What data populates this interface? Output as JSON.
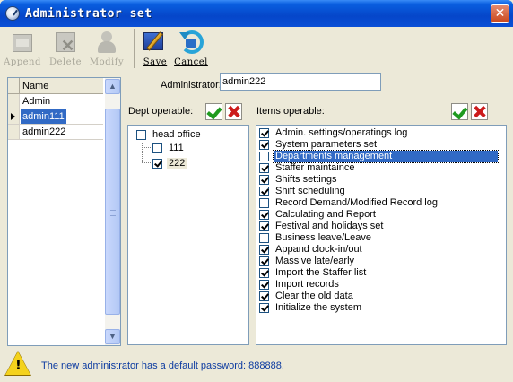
{
  "window": {
    "title": "Administrator set",
    "close_glyph": "✕"
  },
  "toolbar": {
    "append_label": "Append",
    "delete_label": "Delete",
    "modify_label": "Modify",
    "save_label": "Save",
    "cancel_label": "Cancel"
  },
  "user_list": {
    "header": "Name",
    "rows": [
      "Admin",
      "admin111",
      "admin222"
    ],
    "selected_index": 1
  },
  "administrator": {
    "label": "Administrator:",
    "value": "admin222"
  },
  "dept": {
    "label": "Dept operable:",
    "tree": [
      {
        "label": "head office",
        "checked": false
      },
      {
        "label": "111",
        "checked": false
      },
      {
        "label": "222",
        "checked": true
      }
    ]
  },
  "items": {
    "label": "Items operable:",
    "list": [
      {
        "label": "Admin. settings/operatings log",
        "checked": true
      },
      {
        "label": "System parameters set",
        "checked": true
      },
      {
        "label": "Departments management",
        "checked": false
      },
      {
        "label": "Staffer maintaince",
        "checked": true
      },
      {
        "label": "Shifts settings",
        "checked": true
      },
      {
        "label": "Shift scheduling",
        "checked": true
      },
      {
        "label": "Record Demand/Modified Record log",
        "checked": false
      },
      {
        "label": "Calculating and Report",
        "checked": true
      },
      {
        "label": "Festival and holidays set",
        "checked": true
      },
      {
        "label": "Business leave/Leave",
        "checked": false
      },
      {
        "label": "Appand clock-in/out",
        "checked": true
      },
      {
        "label": "Massive late/early",
        "checked": true
      },
      {
        "label": "Import the Staffer list",
        "checked": true
      },
      {
        "label": "Import records",
        "checked": true
      },
      {
        "label": "Clear the old data",
        "checked": true
      },
      {
        "label": "Initialize the system",
        "checked": true
      }
    ],
    "highlighted_index": 2
  },
  "status": {
    "message": "The new administrator has a default password: 888888.",
    "warning_mark": "!"
  },
  "colors": {
    "titlebar": "#0546c9",
    "selection": "#316ac5",
    "status_text": "#0b3aa0",
    "check_green": "#1f9a1f",
    "cross_red": "#cc1b1b"
  }
}
